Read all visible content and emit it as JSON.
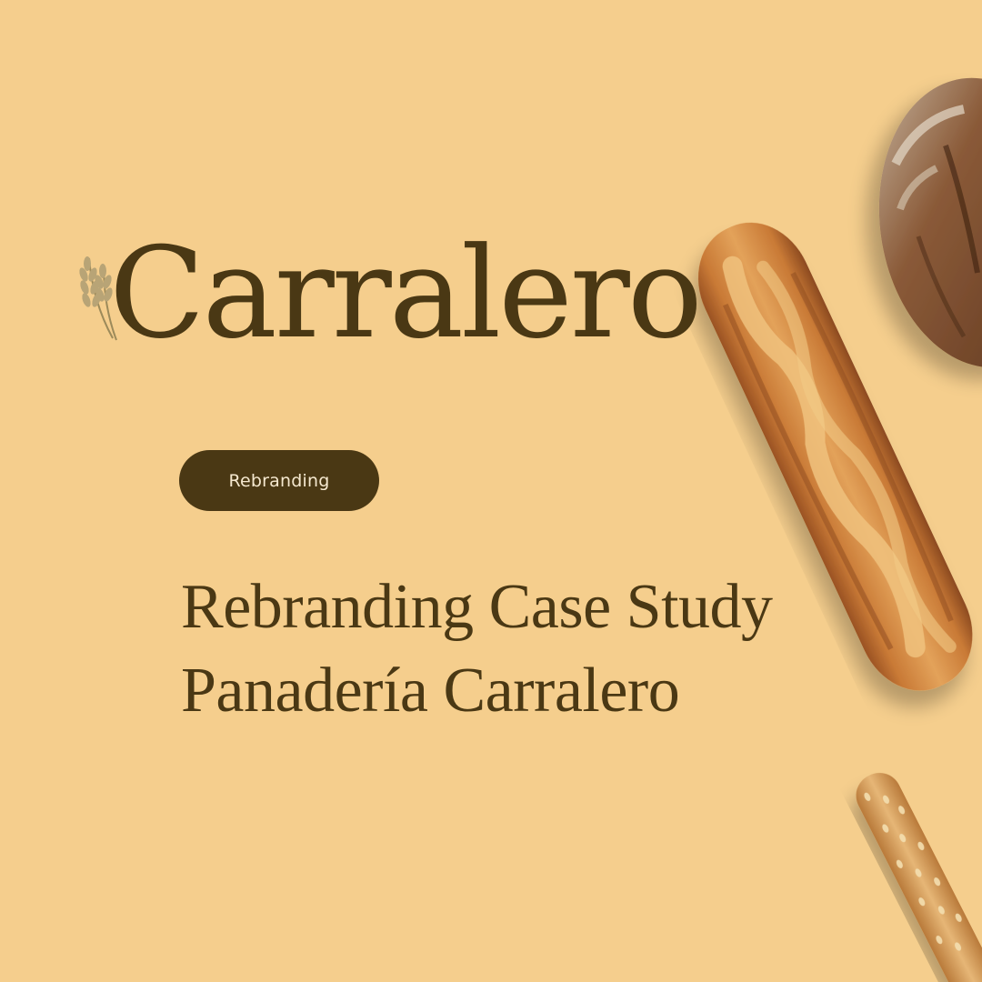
{
  "colors": {
    "background": "#F5CE8D",
    "brand_dark": "#4A3814",
    "tag_text": "#F5E8CF",
    "crust_light": "#D9954A",
    "crust_dark": "#9A5223",
    "crumb": "#E8B870",
    "sourdough": "#7A4A2C",
    "sesame": "#E0B470"
  },
  "logo": {
    "wordmark": "Carralero",
    "icon": "wheat-icon"
  },
  "tag": {
    "label": "Rebranding"
  },
  "headline": {
    "line1": "Rebranding Case Study",
    "line2": "Panadería Carralero"
  },
  "images": {
    "baguette": "baguette-image",
    "sourdough": "sourdough-loaf-image",
    "breadstick": "sesame-breadstick-image"
  }
}
